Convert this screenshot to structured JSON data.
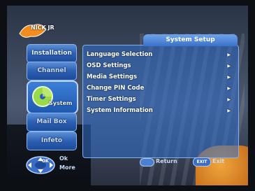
{
  "logo": {
    "text": "NICK JR"
  },
  "nav": {
    "items": [
      {
        "label": "Installation"
      },
      {
        "label": "Channel"
      },
      {
        "label": "System"
      },
      {
        "label": "Mail Box"
      },
      {
        "label": "Infeto"
      }
    ]
  },
  "menu": {
    "title": "System Setup",
    "items": [
      {
        "label": "Language Selection"
      },
      {
        "label": "OSD Settings"
      },
      {
        "label": "Media Settings"
      },
      {
        "label": "Change PIN Code"
      },
      {
        "label": "Timer Settings"
      },
      {
        "label": "System Information"
      }
    ]
  },
  "footer": {
    "ok_label": "OK",
    "ok_hint": "Ok",
    "more_hint": "More",
    "return_label": "Return",
    "exit_key": "EXIT",
    "exit_label": "Exit"
  },
  "colors": {
    "panel": "#326ec8",
    "nav": "#2d5fb3",
    "accent": "#88b4ee"
  }
}
